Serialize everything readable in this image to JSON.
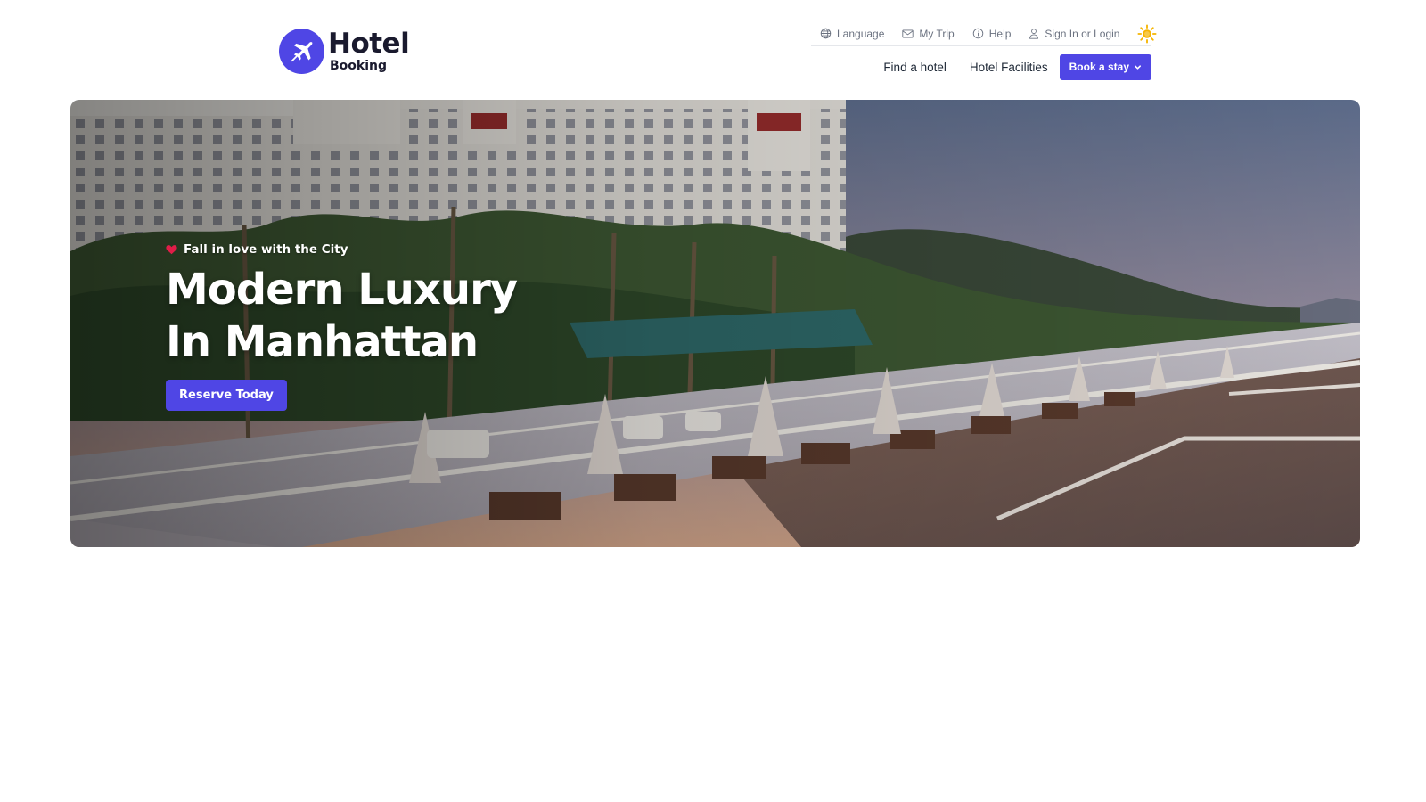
{
  "brand": {
    "name": "Hotel",
    "sub": "Booking",
    "icon": "airplane-icon",
    "color": "#4f46e5"
  },
  "utility_nav": [
    {
      "label": "Language",
      "icon": "globe-icon"
    },
    {
      "label": "My Trip",
      "icon": "envelope-icon"
    },
    {
      "label": "Help",
      "icon": "info-icon"
    },
    {
      "label": "Sign In or Login",
      "icon": "user-icon"
    }
  ],
  "theme_toggle": {
    "icon": "sun-icon",
    "color": "#f5b400"
  },
  "main_nav": {
    "links": [
      "Find a hotel",
      "Hotel Facilities"
    ],
    "cta_label": "Book a stay",
    "cta_icon": "chevron-down-icon"
  },
  "hero": {
    "tagline": "Fall in love with the City",
    "tagline_icon": "heart-icon",
    "headline_line1": "Modern Luxury",
    "headline_line2": "In Manhattan",
    "cta_label": "Reserve Today"
  },
  "colors": {
    "accent": "#4f46e5",
    "heart": "#e11d48"
  }
}
